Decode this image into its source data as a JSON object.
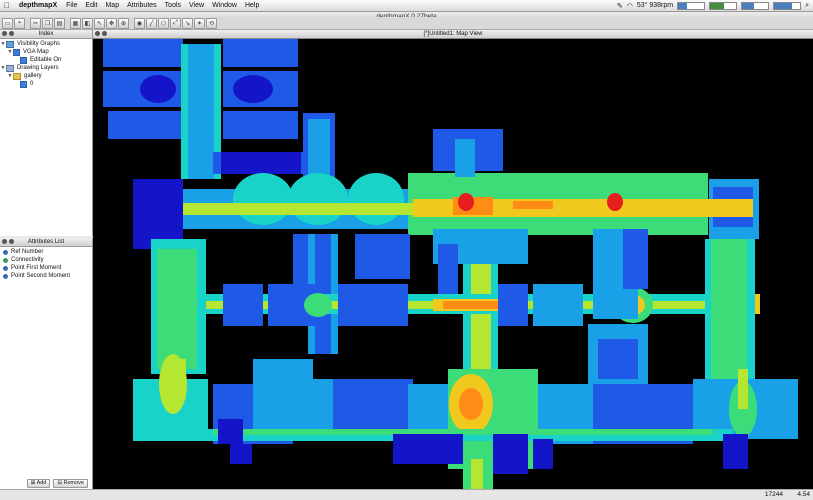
{
  "menubar": {
    "app_name": "depthmapX",
    "items": [
      "File",
      "Edit",
      "Map",
      "Attributes",
      "Tools",
      "View",
      "Window",
      "Help"
    ],
    "rpm": "53° 938rpm"
  },
  "window_title": "depthmapX 0.27beta",
  "toolbar": {
    "icons": [
      "open-icon",
      "save-icon",
      "cut-icon",
      "copy-icon",
      "paste-icon",
      "grid-icon",
      "fill-icon",
      "select-icon",
      "pan-icon",
      "zoom-icon",
      "isovist-icon",
      "line-icon",
      "polygon-icon",
      "axial-icon",
      "step-icon",
      "graph-icon",
      "agent-icon"
    ]
  },
  "index_panel": {
    "title": "Index",
    "tree": [
      {
        "label": "Visibility Graphs",
        "level": 0,
        "kind": "group"
      },
      {
        "label": "VGA Map",
        "level": 1,
        "kind": "check"
      },
      {
        "label": "Editable On",
        "level": 2,
        "kind": "check"
      },
      {
        "label": "Drawing Layers",
        "level": 0,
        "kind": "group"
      },
      {
        "label": "gallery",
        "level": 1,
        "kind": "folder"
      },
      {
        "label": "0",
        "level": 2,
        "kind": "check"
      }
    ]
  },
  "attr_panel": {
    "title": "Attributes List",
    "items": [
      {
        "label": "Ref Number",
        "color": "#2d6db3"
      },
      {
        "label": "Connectivity",
        "color": "#3a9a5a"
      },
      {
        "label": "Point First Moment",
        "color": "#2d6db3"
      },
      {
        "label": "Point Second Moment",
        "color": "#2d6db3"
      }
    ],
    "add_label": "Add",
    "remove_label": "Remove"
  },
  "map_window": {
    "title": "[*]Untitled1: Map View",
    "palette": [
      "#1414c8",
      "#1e5ae6",
      "#1aa0e6",
      "#19d2c8",
      "#3cdc78",
      "#b4e632",
      "#f0c81e",
      "#ff8c14",
      "#e61e1e"
    ]
  },
  "status": {
    "count": "17244",
    "zoom": "4.54"
  }
}
